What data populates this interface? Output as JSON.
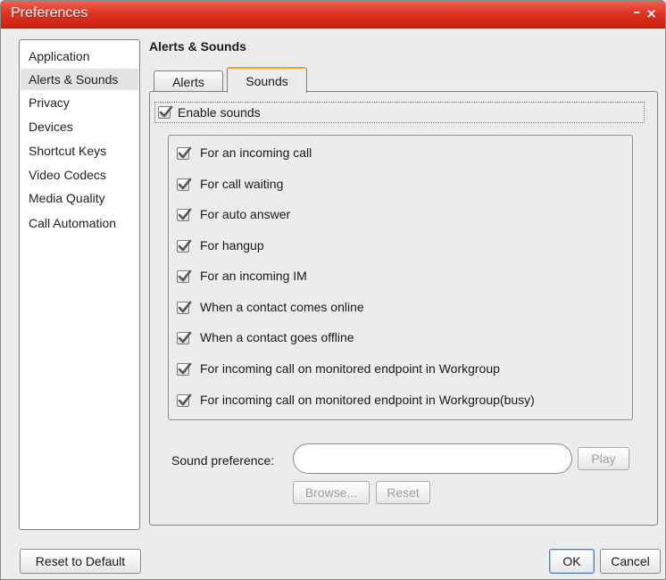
{
  "window": {
    "title": "Preferences",
    "minimize": "–",
    "close": "×"
  },
  "sidebar": {
    "items": [
      {
        "label": "Application"
      },
      {
        "label": "Alerts & Sounds"
      },
      {
        "label": "Privacy"
      },
      {
        "label": "Devices"
      },
      {
        "label": "Shortcut Keys"
      },
      {
        "label": "Video Codecs"
      },
      {
        "label": "Media Quality"
      },
      {
        "label": "Call Automation"
      }
    ],
    "selected": "Alerts & Sounds"
  },
  "main": {
    "section_title": "Alerts & Sounds",
    "tabs": [
      {
        "label": "Alerts"
      },
      {
        "label": "Sounds"
      }
    ],
    "active_tab": "Sounds",
    "enable_sounds": {
      "label": "Enable sounds",
      "checked": true
    },
    "sound_options": [
      {
        "label": "For an incoming call",
        "checked": true
      },
      {
        "label": "For call waiting",
        "checked": true
      },
      {
        "label": "For auto answer",
        "checked": true
      },
      {
        "label": "For hangup",
        "checked": true
      },
      {
        "label": "For an incoming IM",
        "checked": true
      },
      {
        "label": "When a contact comes online",
        "checked": true
      },
      {
        "label": "When a contact goes offline",
        "checked": true
      },
      {
        "label": "For incoming call on monitored endpoint in Workgroup",
        "checked": true
      },
      {
        "label": "For incoming call on monitored endpoint in Workgroup(busy)",
        "checked": true
      }
    ],
    "sound_preference": {
      "label": "Sound preference:",
      "value": "",
      "play_label": "Play",
      "browse_label": "Browse...",
      "reset_label": "Reset"
    }
  },
  "footer": {
    "reset_default_label": "Reset to Default",
    "ok_label": "OK",
    "cancel_label": "Cancel"
  },
  "colors": {
    "titlebar": "#de3524",
    "active_tab_accent": "#f0a32e",
    "checkmark": "#555555"
  }
}
